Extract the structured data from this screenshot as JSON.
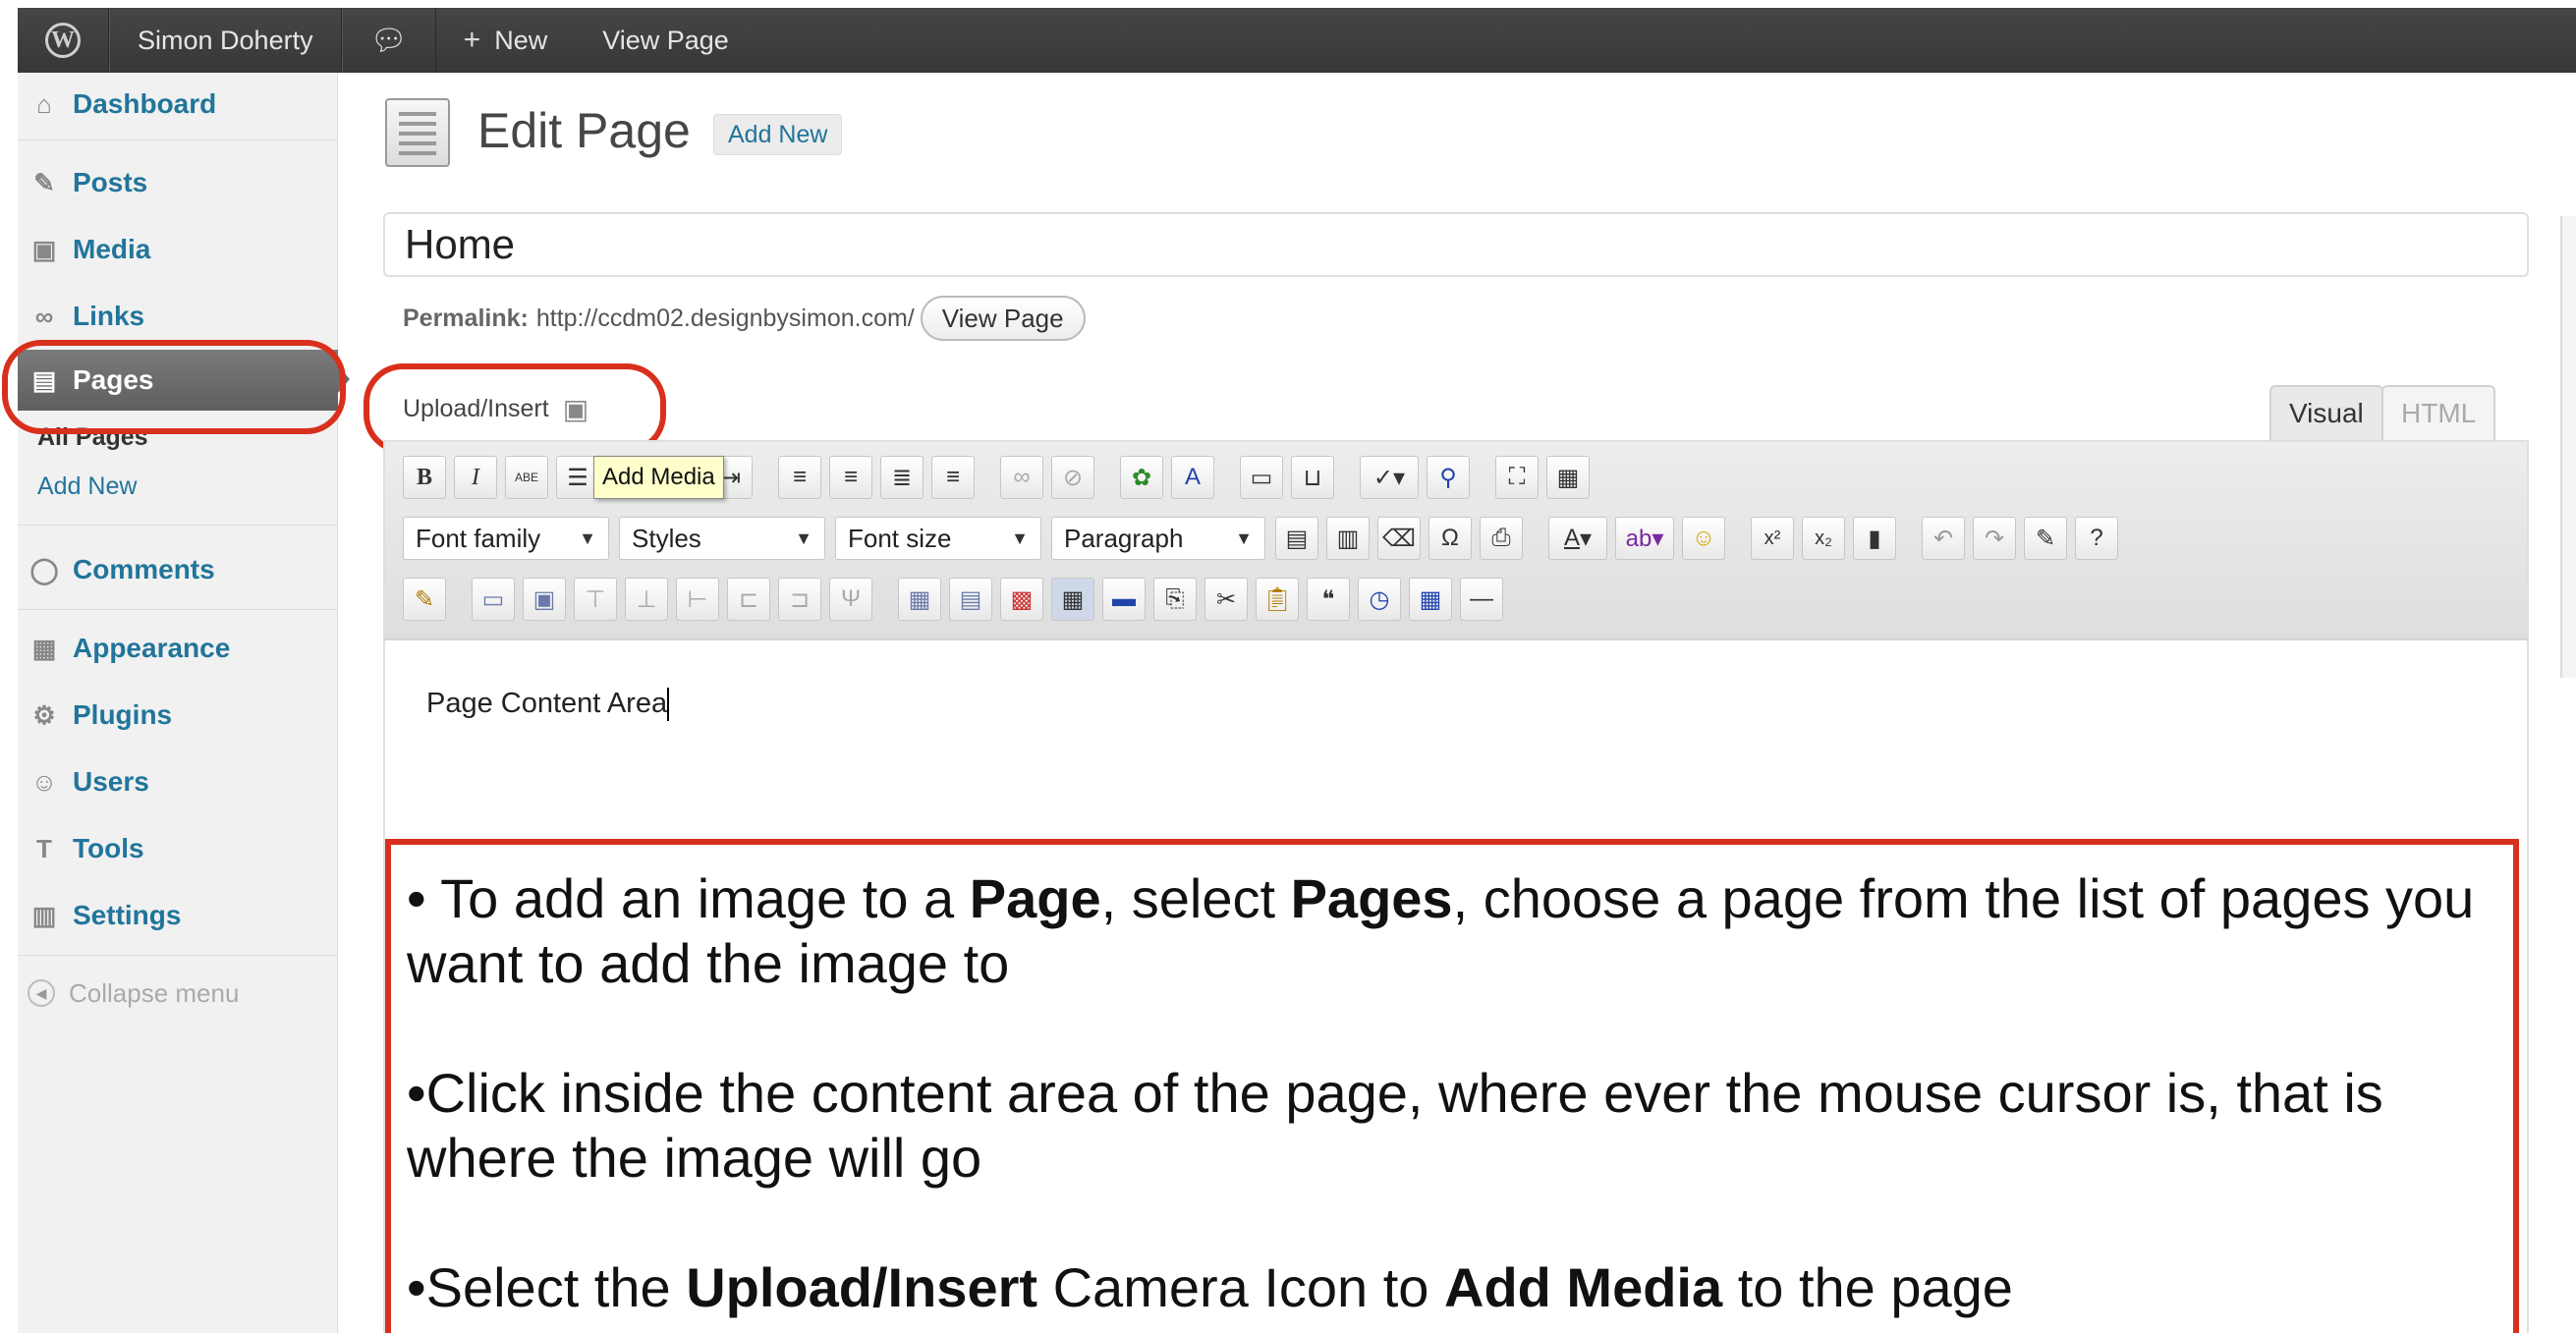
{
  "admin_bar": {
    "site_name": "Simon Doherty",
    "comments_icon": "speech-bubble-icon",
    "new_label": "New",
    "view_page_label": "View Page"
  },
  "sidebar": {
    "items": [
      {
        "label": "Dashboard",
        "icon": "home-icon"
      },
      {
        "label": "Posts",
        "icon": "pin-icon"
      },
      {
        "label": "Media",
        "icon": "camera-icon"
      },
      {
        "label": "Links",
        "icon": "link-icon"
      },
      {
        "label": "Pages",
        "icon": "pages-icon"
      },
      {
        "label": "Comments",
        "icon": "speech-bubble-icon"
      },
      {
        "label": "Appearance",
        "icon": "appearance-icon"
      },
      {
        "label": "Plugins",
        "icon": "plug-icon"
      },
      {
        "label": "Users",
        "icon": "users-icon"
      },
      {
        "label": "Tools",
        "icon": "tools-icon"
      },
      {
        "label": "Settings",
        "icon": "settings-icon"
      }
    ],
    "pages_submenu": {
      "all_pages": "All Pages",
      "add_new": "Add New"
    },
    "collapse_label": "Collapse menu"
  },
  "main": {
    "page_title": "Edit Page",
    "add_new_label": "Add New",
    "title_value": "Home",
    "permalink_label": "Permalink:",
    "permalink_url": "http://ccdm02.designbysimon.com/",
    "view_page_button": "View Page",
    "upload_insert_label": "Upload/Insert",
    "tabs": {
      "visual": "Visual",
      "html": "HTML"
    },
    "toolbar": {
      "bold": "B",
      "italic": "I",
      "strike": "ABE",
      "tooltip": "Add Media",
      "font_family": "Font family",
      "styles": "Styles",
      "font_size": "Font size",
      "paragraph": "Paragraph",
      "omega": "Ω",
      "text_color": "A",
      "superscript": "x²",
      "subscript": "x₂"
    },
    "content_text": "Page Content Area"
  },
  "instructions": {
    "p1_a": "• To add an image to a ",
    "p1_b": "Page",
    "p1_c": ", select ",
    "p1_d": "Pages",
    "p1_e": ", choose a page from the list of pages you want to add the image to",
    "p2": "•Click inside the content area of the page, where ever the mouse cursor is, that is where the image will go",
    "p3_a": "•Select the ",
    "p3_b": "Upload/Insert",
    "p3_c": " Camera Icon to ",
    "p3_d": "Add Media",
    "p3_e": " to the page"
  },
  "colors": {
    "accent_link": "#21759b",
    "highlight_red": "#d9301d",
    "admin_bar": "#464646"
  }
}
